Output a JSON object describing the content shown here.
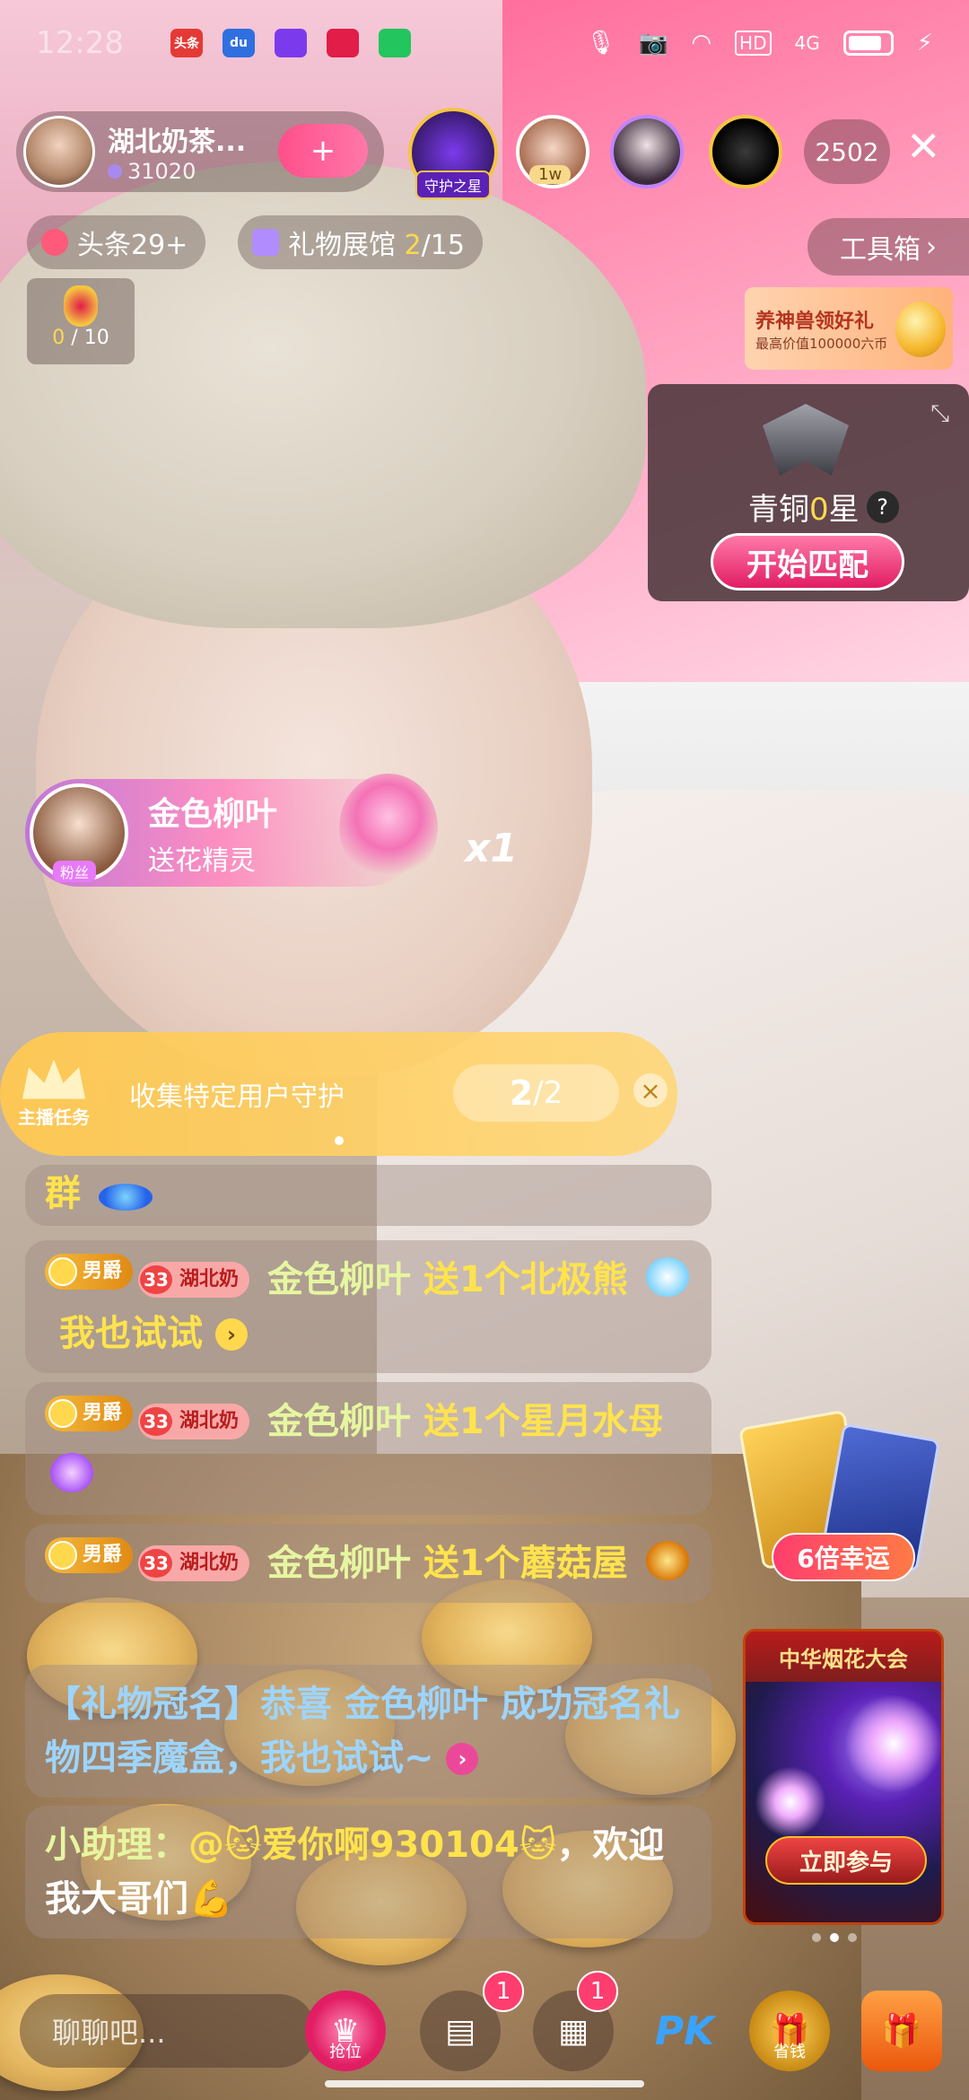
{
  "status_bar": {
    "time": "12:28",
    "apps": [
      {
        "name": "toutiao-app-icon",
        "label": "头条",
        "color": "#e53935"
      },
      {
        "name": "baidu-app-icon",
        "label": "du",
        "color": "#2f6fe0"
      },
      {
        "name": "video-app-icon",
        "label": "",
        "color": "#7c3aed"
      },
      {
        "name": "dianyou-app-icon",
        "label": "",
        "color": "#e11d48"
      },
      {
        "name": "chat-app-icon",
        "label": "",
        "color": "#22c55e"
      }
    ],
    "network": "4G",
    "hd": "HD"
  },
  "host": {
    "name": "湖北奶茶...",
    "fans": "31020",
    "follow_symbol": "+"
  },
  "guard_badge": "守护之星",
  "viewers": [
    {
      "tag": "1w"
    }
  ],
  "viewer_count": "2502",
  "chips": {
    "headline": "头条29+",
    "gift_hall_label": "礼物展馆 ",
    "gift_hall_progress": "2",
    "gift_hall_total": "/15"
  },
  "toolbox": {
    "label": "工具箱",
    "chevron": "›"
  },
  "gift_progress": {
    "current": "0",
    "total": " / 10"
  },
  "promo": {
    "title": "养神兽领好礼",
    "subtitle": "最高价值100000六币"
  },
  "rank_card": {
    "level_text": "青铜",
    "stars": "0",
    "stars_unit": "星",
    "help": "?",
    "match_button": "开始匹配"
  },
  "gift_popup": {
    "sender": "金色柳叶",
    "action": "送花精灵",
    "fan_tag": "粉丝",
    "combo": "x1"
  },
  "task_bar": {
    "label_icon": "主播任务",
    "text": "收集特定用户守护",
    "progress": "2",
    "total": " /2",
    "close": "×"
  },
  "chat": [
    {
      "tail": "群"
    },
    {
      "badge_rank": "男爵",
      "badge_level": "33",
      "badge_club": "湖北奶",
      "user": "金色柳叶",
      "action": " 送1个北极熊",
      "extra": "我也试试",
      "arrow": "›"
    },
    {
      "badge_rank": "男爵",
      "badge_level": "33",
      "badge_club": "湖北奶",
      "user": "金色柳叶",
      "action": " 送1个星月水母"
    },
    {
      "badge_rank": "男爵",
      "badge_level": "33",
      "badge_club": "湖北奶",
      "user": "金色柳叶",
      "action": " 送1个蘑菇屋"
    },
    {
      "text": "【礼物冠名】恭喜 金色柳叶 成功冠名礼物四季魔盒，我也试试~",
      "arrow": "›"
    },
    {
      "prefix": "小助理：",
      "mention": "@🐱爱你啊930104🐱",
      "text": "，欢迎我大哥们💪"
    }
  ],
  "activities": {
    "lucky_label": "6倍幸运",
    "fireworks_title": "中华烟花大会",
    "fireworks_button": "立即参与"
  },
  "bottom_bar": {
    "input_placeholder": "聊聊吧...",
    "seat_label": "抢位",
    "msg_badge": "1",
    "grid_badge": "1",
    "pk_label": "PK",
    "save_label": "省钱"
  }
}
